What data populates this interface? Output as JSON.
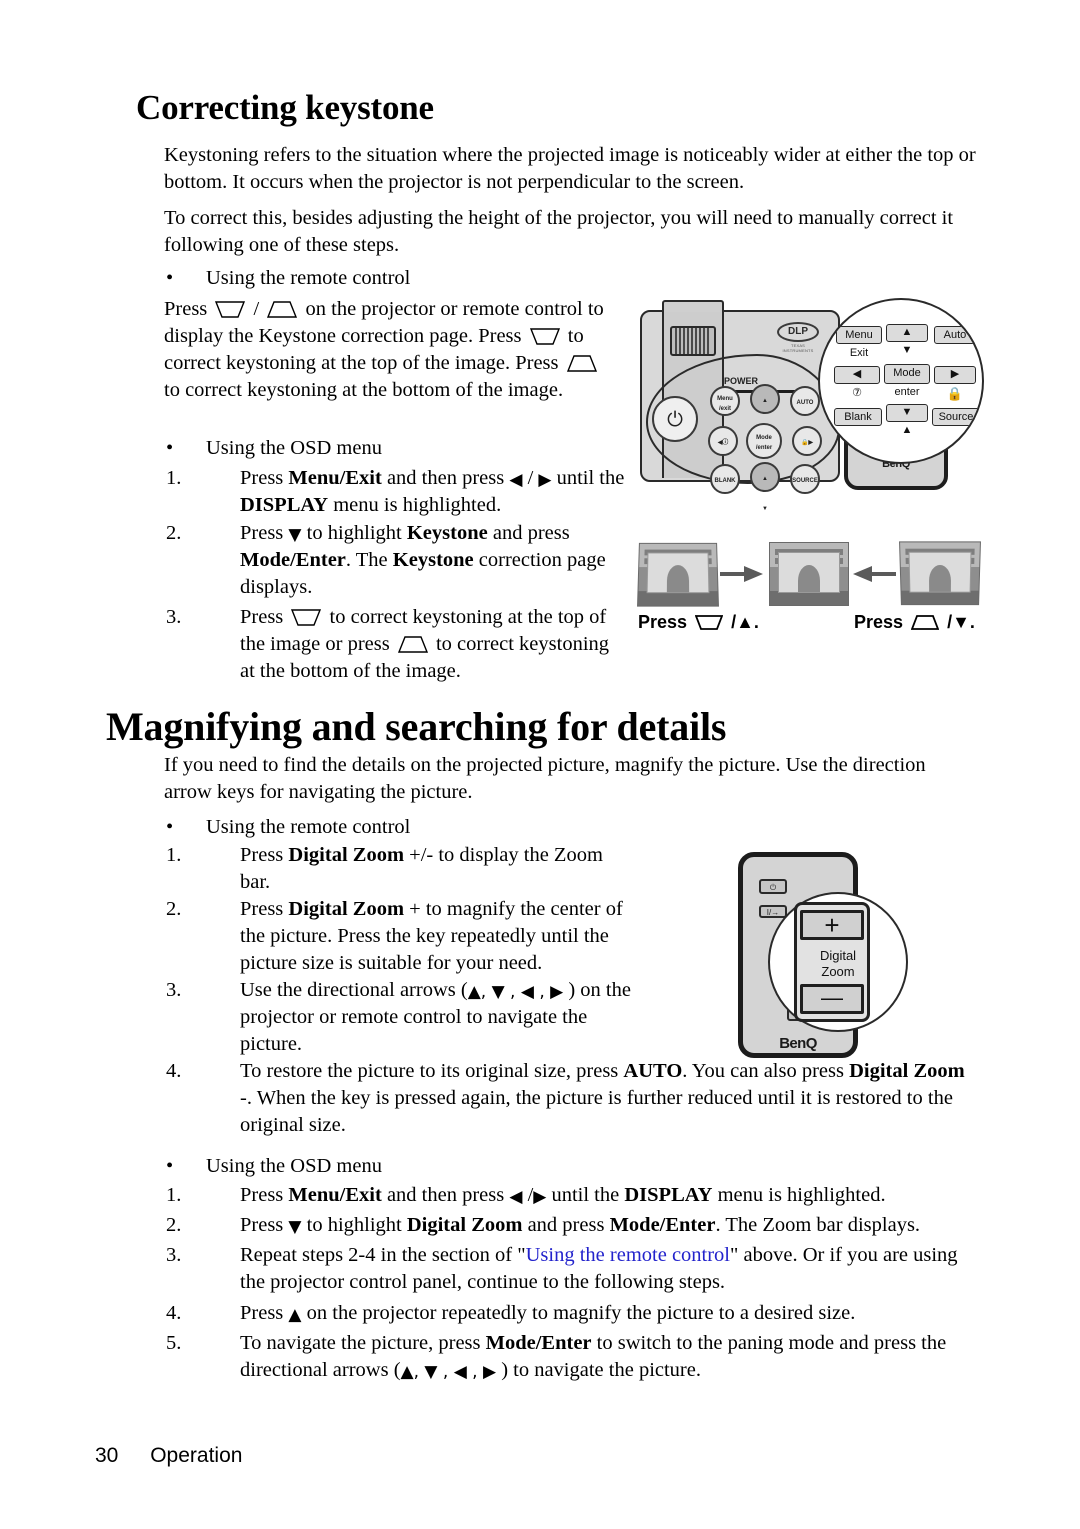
{
  "document": {
    "footer": {
      "page_number": "30",
      "section": "Operation"
    }
  },
  "sections": [
    {
      "id": "correcting-keystone",
      "heading": "Correcting keystone",
      "paragraphs": [
        "Keystoning refers to the situation where the projected image is noticeably wider at either the top or bottom. It occurs when the projector is not perpendicular to the screen.",
        "To correct this, besides adjusting the height of the projector, you will need to manually correct it following one of these steps."
      ],
      "remote_bullet": "Using the remote control",
      "remote_text_1": "Press",
      "remote_text_2": "/",
      "remote_text_3": "on the projector or remote control to display the Keystone correction page. Press",
      "remote_text_4": "to correct keystoning at the top of the image. Press",
      "remote_text_5": "to correct keystoning at the bottom of the image.",
      "osd_bullet": "Using the OSD menu",
      "steps": [
        {
          "num": "1.",
          "parts": [
            "Press ",
            "Menu/Exit",
            " and then press ",
            "◀",
            " / ",
            "▶",
            " until the ",
            "DISPLAY",
            " menu is highlighted."
          ]
        },
        {
          "num": "2.",
          "parts": [
            "Press ",
            "▼",
            " to highlight ",
            "Keystone",
            " and press ",
            "Mode/Enter",
            ". The ",
            "Keystone",
            " correction page displays."
          ]
        },
        {
          "num": "3.",
          "text_a": "Press",
          "text_b": "to correct keystoning at the top of the image or press",
          "text_c": "to correct keystoning at the bottom of the image."
        }
      ]
    },
    {
      "id": "magnifying-searching",
      "heading": "Magnifying and searching for details",
      "paragraph": "If you need to find the details on the projected picture, magnify the picture. Use the direction arrow keys for navigating the picture.",
      "remote_bullet": "Using the remote control",
      "remote_steps": [
        {
          "num": "1.",
          "pre": "Press ",
          "bold": "Digital Zoom",
          " ": "",
          "post": " +/- to display the Zoom bar."
        },
        {
          "num": "2.",
          "pre": "Press ",
          "bold": "Digital Zoom",
          "post": " + to magnify the center of the picture. Press the key repeatedly until the picture size is suitable for your need."
        },
        {
          "num": "3.",
          "pre": "Use the directional arrows (",
          "arrows": "▲, ▼ , ◀ , ▶",
          "post": " ) on the projector or remote control to navigate the picture."
        },
        {
          "num": "4.",
          "pre": "To restore the picture to its original size, press ",
          "bold1": "AUTO",
          "mid": ". You can also press ",
          "bold2": "Digital Zoom",
          "post": " -. When the key is pressed again, the picture is further reduced until it is restored to the original size."
        }
      ],
      "osd_bullet": "Using the OSD menu",
      "osd_steps": [
        {
          "num": "1.",
          "text": "Press Menu/Exit and then press ◀ / ▶ until the DISPLAY menu is highlighted."
        },
        {
          "num": "2.",
          "text": "Press ▼ to highlight Digital Zoom and press Mode/Enter. The Zoom bar displays."
        },
        {
          "num": "3.",
          "text": "Repeat steps 2-4 in the section of \"Using the remote control\" above. Or if you are using the projector control panel, continue to the following steps.",
          "link_text": "Using the remote control"
        },
        {
          "num": "4.",
          "text": "Press ▲ on the projector repeatedly to magnify the picture to a desired size."
        },
        {
          "num": "5.",
          "text": "To navigate the picture, press Mode/Enter to switch to the paning mode and press the directional arrows (▲, ▼ , ◀ , ▶ ) to navigate the picture."
        }
      ]
    }
  ],
  "figures": {
    "projector": {
      "brand_logo": "DLP",
      "brand_sub": "TEXAS INSTRUMENTS",
      "power_label": "POWER",
      "buttons": [
        {
          "name": "menu-exit",
          "label": "Menu\nExit"
        },
        {
          "name": "keystone-up",
          "label": "▲▼"
        },
        {
          "name": "auto",
          "label": "AUTO"
        },
        {
          "name": "left",
          "label": "◀"
        },
        {
          "name": "mode-enter",
          "label": "Mode\n/enter"
        },
        {
          "name": "right",
          "label": "▶"
        },
        {
          "name": "blank",
          "label": "BLANK"
        },
        {
          "name": "keystone-down",
          "label": "▲▼"
        },
        {
          "name": "source",
          "label": "SOURCE"
        }
      ],
      "power_icon": "⏻",
      "remote_brand": "BenQ",
      "magnified_keys": {
        "menu": "Menu",
        "exit": "Exit",
        "auto": "Auto",
        "up": "▲",
        "up_small": "▼",
        "left": "◀",
        "left_sub": "⑦",
        "mode": "Mode",
        "enter": "enter",
        "right": "▶",
        "right_sub": "🔒",
        "blank": "Blank",
        "down": "▼",
        "down_small": "▲",
        "source": "Source"
      }
    },
    "keystone_demo": {
      "left_caption_prefix": "Press",
      "left_caption_suffix": "/▲.",
      "right_caption_prefix": "Press",
      "right_caption_suffix": "/▼."
    },
    "remote_zoom": {
      "caption_line1": "Digital",
      "caption_line2": "Zoom",
      "plus": "+",
      "minus": "—",
      "brand": "BenQ",
      "power_key": "⏻",
      "io_key": "I/→"
    }
  },
  "colors": {
    "link": "#2222cc",
    "text": "#000000",
    "page_bg": "#ffffff",
    "device_grey": "#d4d4d4",
    "device_outline": "#1c1c1c"
  }
}
